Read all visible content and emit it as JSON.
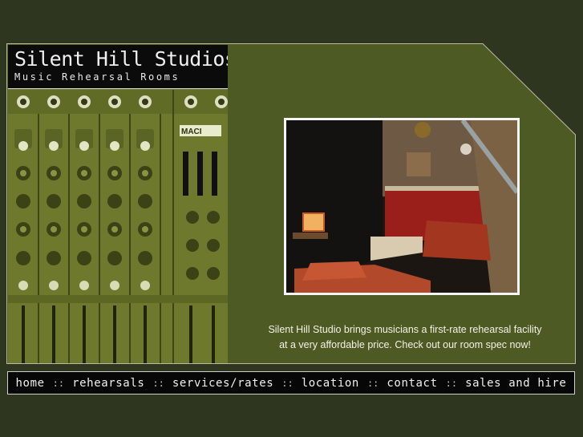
{
  "brand": {
    "title": "Silent Hill Studios",
    "subtitle": "Music Rehearsal Rooms"
  },
  "hero": {
    "tagline_line1": "Silent Hill Studio brings musicians a first-rate rehearsal facility",
    "tagline_line2": "at a very affordable price. Check out our room spec now!"
  },
  "nav": {
    "items": [
      "home",
      "rehearsals",
      "services/rates",
      "location",
      "contact",
      "sales and hire"
    ],
    "separator": "::"
  },
  "colors": {
    "page_background": "#2e3620",
    "panel": "#4d5a23",
    "mixer_tint": "#6f7a2e",
    "nav_background": "#070707",
    "text": "#f2f2e6"
  }
}
